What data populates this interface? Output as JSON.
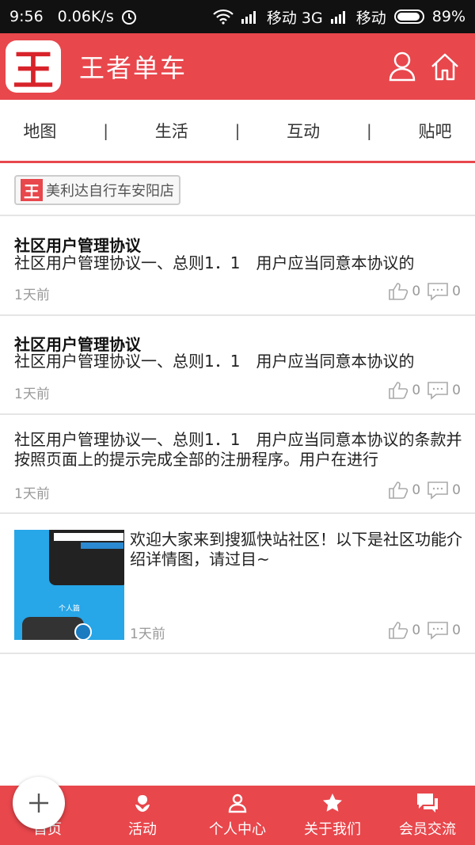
{
  "status_bar": {
    "time": "9:56",
    "speed": "0.06K/s",
    "carrier1": "移动 3G",
    "carrier2": "移动",
    "battery": "89%"
  },
  "app": {
    "logo_char": "王",
    "title": "王者单车"
  },
  "nav": {
    "items": [
      "地图",
      "生活",
      "互动",
      "贴吧"
    ],
    "separator": "|"
  },
  "shop_tag": {
    "icon_char": "王",
    "label": "美利达自行车安阳店"
  },
  "posts": [
    {
      "title": "社区用户管理协议",
      "body": "社区用户管理协议一、总则1．1　用户应当同意本协议的",
      "time": "1天前",
      "likes": "0",
      "comments": "0"
    },
    {
      "title": "社区用户管理协议",
      "body": "社区用户管理协议一、总则1．1　用户应当同意本协议的",
      "time": "1天前",
      "likes": "0",
      "comments": "0"
    },
    {
      "body": "社区用户管理协议一、总则1．1　用户应当同意本协议的条款并按照页面上的提示完成全部的注册程序。用户在进行",
      "time": "1天前",
      "likes": "0",
      "comments": "0"
    },
    {
      "body": "欢迎大家来到搜狐快站社区！以下是社区功能介绍详情图，请过目~",
      "time": "1天前",
      "likes": "0",
      "comments": "0",
      "thumb_caption": "个人篇"
    }
  ],
  "tabbar": {
    "items": [
      "首页",
      "活动",
      "个人中心",
      "关于我们",
      "会员交流"
    ]
  },
  "colors": {
    "brand": "#e8474c",
    "muted": "#999999"
  }
}
